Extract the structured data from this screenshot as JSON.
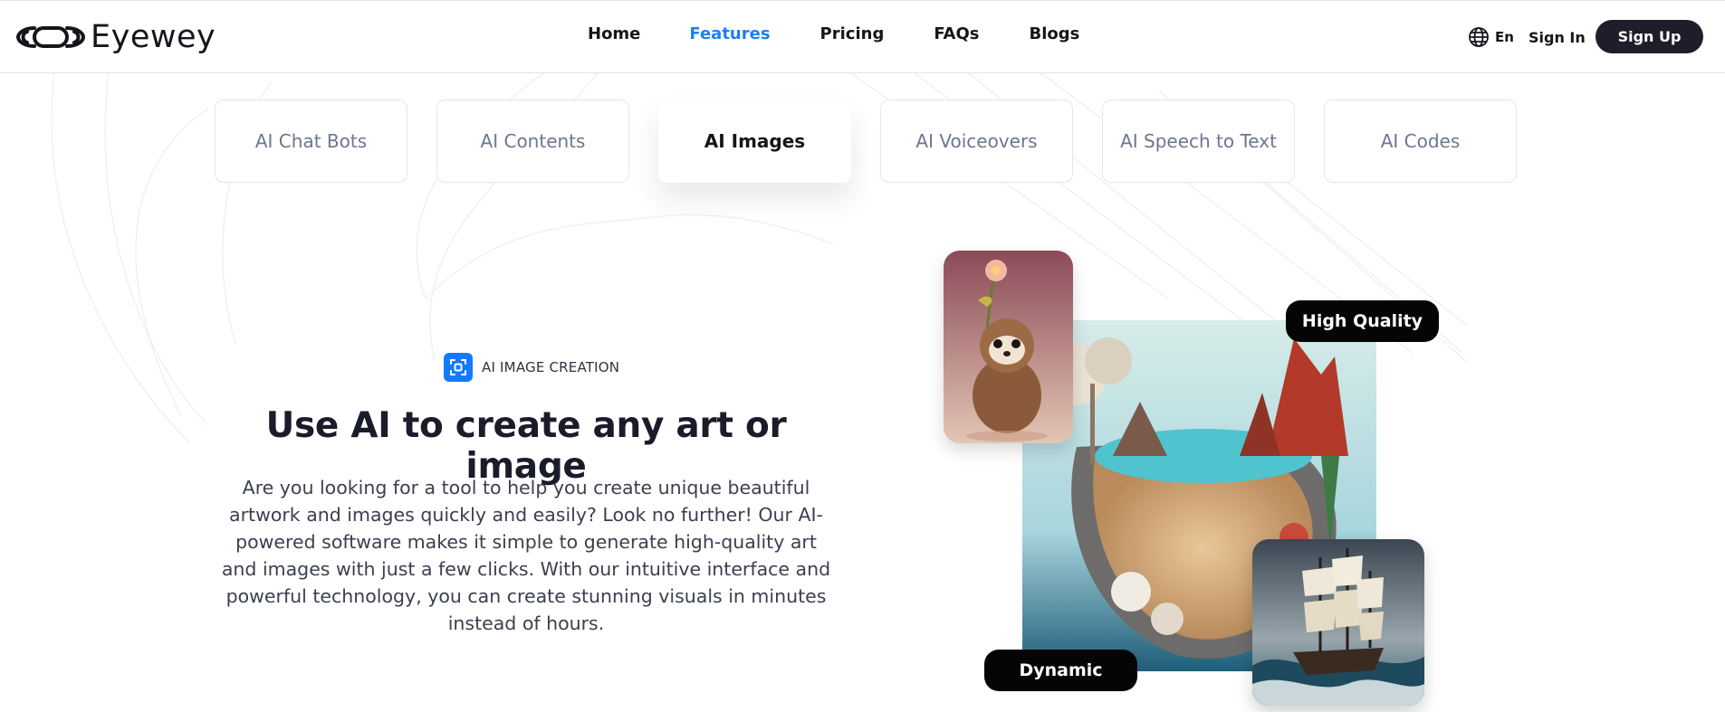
{
  "header": {
    "logo_text": "Eyewey",
    "nav": [
      {
        "label": "Home"
      },
      {
        "label": "Features"
      },
      {
        "label": "Pricing"
      },
      {
        "label": "FAQs"
      },
      {
        "label": "Blogs"
      }
    ],
    "active_nav": "Features",
    "language": "En",
    "sign_in": "Sign In",
    "sign_up": "Sign Up"
  },
  "tabs": [
    {
      "label": "AI Chat Bots"
    },
    {
      "label": "AI Contents"
    },
    {
      "label": "AI Images"
    },
    {
      "label": "AI Voiceovers"
    },
    {
      "label": "AI Speech to Text"
    },
    {
      "label": "AI Codes"
    }
  ],
  "active_tab": "AI Images",
  "feature": {
    "eyebrow": "AI IMAGE CREATION",
    "headline": "Use AI to create any art or image",
    "description": "Are you looking for a tool to help you create unique beautiful artwork and images quickly and easily? Look no further! Our AI-powered software makes it simple to generate high-quality art and images with just a few clicks. With our intuitive interface and powerful technology, you can create stunning visuals in minutes instead of hours.",
    "badges": {
      "top": "High Quality",
      "bottom": "Dynamic"
    }
  },
  "colors": {
    "accent": "#1e7ff0",
    "dark": "#1d1e29",
    "tab_border": "#e3e6ee",
    "muted_text": "#6d7691"
  },
  "icons": [
    "globe-icon",
    "scan-icon",
    "logo-mark-icon"
  ]
}
